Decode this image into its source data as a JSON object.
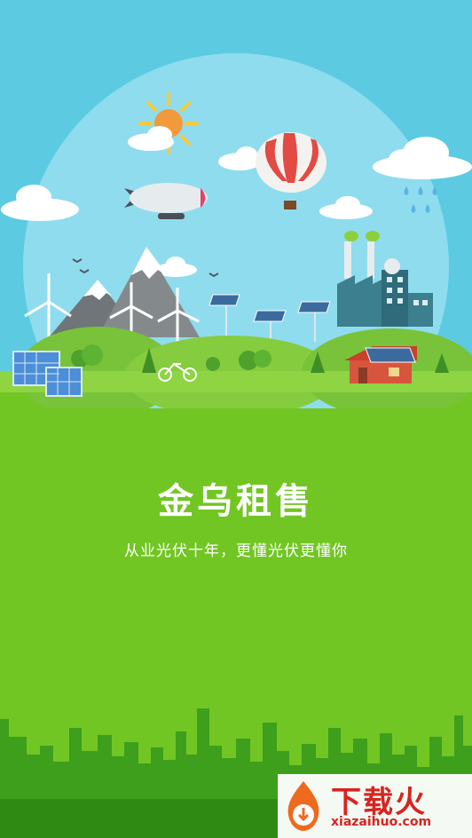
{
  "splash": {
    "title": "金乌租售",
    "slogan": "从业光伏十年，更懂光伏更懂你"
  },
  "watermark": {
    "brand": "下载火",
    "url": "xiazaihuo.com",
    "icon": "flame-download-icon"
  },
  "colors": {
    "sky": "#5ccbe2",
    "ground": "#72c623",
    "city": "#3d9f1c",
    "watermark_red": "#d8241f"
  }
}
